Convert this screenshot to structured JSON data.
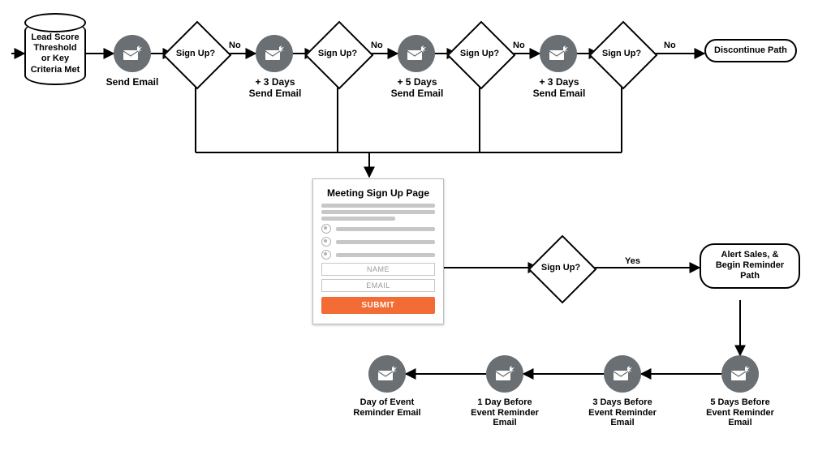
{
  "start": {
    "label": "Lead Score Threshold or Key Criteria Met"
  },
  "emails": {
    "e1": "Send Email",
    "e2": "+ 3 Days\nSend Email",
    "e3": "+ 5 Days\nSend Email",
    "e4": "+ 3 Days\nSend Email"
  },
  "decision_label": "Sign Up?",
  "edge_no": "No",
  "edge_yes": "Yes",
  "terminators": {
    "discontinue": "Discontinue Path",
    "alert": "Alert Sales, & Begin Reminder Path"
  },
  "form": {
    "title": "Meeting Sign Up Page",
    "name_placeholder": "NAME",
    "email_placeholder": "EMAIL",
    "submit_label": "SUBMIT"
  },
  "reminders": {
    "r5": "5 Days Before Event Reminder Email",
    "r3": "3 Days Before Event Reminder Email",
    "r1": "1 Day Before Event Reminder Email",
    "r0": "Day of Event Reminder Email"
  },
  "colors": {
    "node_fill": "#6a6f73",
    "submit_bg": "#f36b35"
  }
}
